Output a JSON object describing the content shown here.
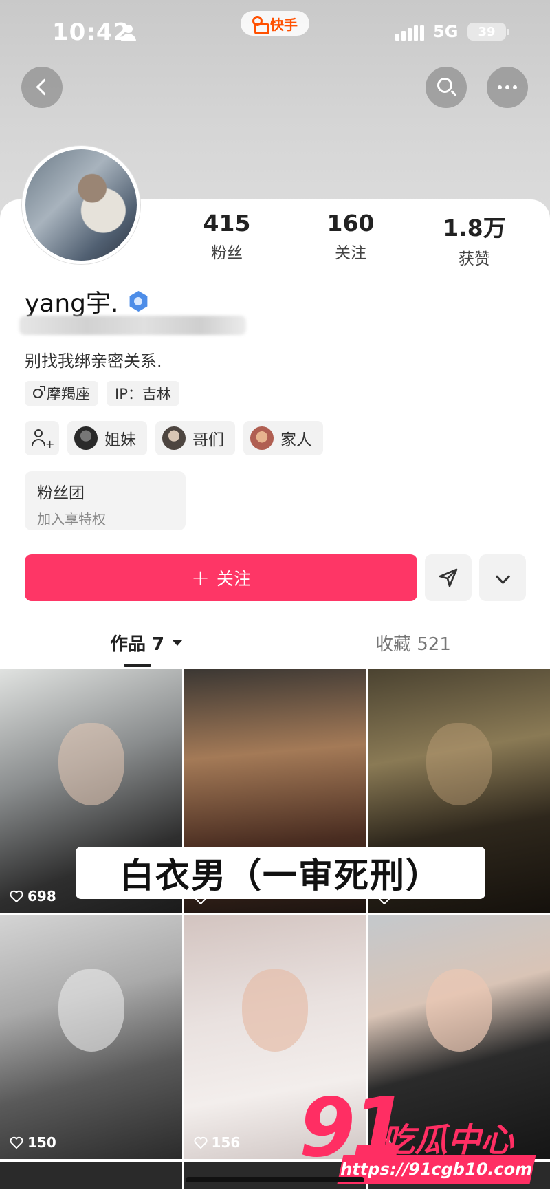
{
  "status_bar": {
    "time": "10:42",
    "app_name": "快手",
    "network": "5G",
    "battery": "39"
  },
  "profile": {
    "stats": [
      {
        "value": "415",
        "label": "粉丝"
      },
      {
        "value": "160",
        "label": "关注"
      },
      {
        "value": "1.8万",
        "label": "获赞"
      }
    ],
    "username": "yang宇.",
    "bio": "别找我绑亲密关系.",
    "tags": [
      "摩羯座",
      "IP：吉林"
    ],
    "groups": [
      {
        "label": "姐妹",
        "avatar_color": "#3a3a3a"
      },
      {
        "label": "哥们",
        "avatar_color": "#5b5048"
      },
      {
        "label": "家人",
        "avatar_color": "#b7786a"
      }
    ],
    "fan_club": {
      "title": "粉丝团",
      "subtitle": "加入享特权"
    },
    "follow_button": "关注"
  },
  "tabs": {
    "works": "作品 7",
    "favorites": "收藏 521"
  },
  "videos": [
    {
      "likes": "698"
    },
    {
      "likes": ""
    },
    {
      "likes": ""
    },
    {
      "likes": "150"
    },
    {
      "likes": "156"
    },
    {
      "likes": ""
    }
  ],
  "overlay_caption": "白衣男（一审死刑）",
  "watermark": {
    "number": "91",
    "text": "吃瓜中心",
    "url": "https://91cgb10.com"
  },
  "colors": {
    "accent": "#fe3666",
    "watermark": "#ff2e63"
  }
}
